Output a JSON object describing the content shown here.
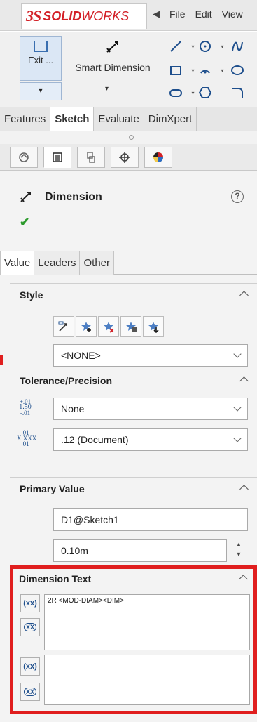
{
  "app": {
    "logo_mark": "3S",
    "logo_bold": "SOLID",
    "logo_rest": "WORKS",
    "menu_arrow": "◀",
    "menu": [
      "File",
      "Edit",
      "View"
    ]
  },
  "command_manager": {
    "exit_label": "Exit ...",
    "smart_dimension_label": "Smart Dimension",
    "dropdown_glyph": "▾"
  },
  "command_tabs": [
    "Features",
    "Sketch",
    "Evaluate",
    "DimXpert"
  ],
  "active_command_tab": "Sketch",
  "property_manager": {
    "title": "Dimension",
    "help_glyph": "?",
    "ok_glyph": "✔",
    "tabs": [
      "Value",
      "Leaders",
      "Other"
    ],
    "active_tab": "Value"
  },
  "style": {
    "heading": "Style",
    "selected": "<NONE>"
  },
  "tolerance": {
    "heading": "Tolerance/Precision",
    "tolerance_type": "None",
    "precision": ".12 (Document)",
    "tol_icon_lines": [
      "+.01",
      "1.50",
      "-.01"
    ],
    "prec_icon_lines": [
      ".01",
      "X.XXX",
      ".01"
    ]
  },
  "primary_value": {
    "heading": "Primary Value",
    "name": "D1@Sketch1",
    "value": "0.10m"
  },
  "dimension_text": {
    "heading": "Dimension Text",
    "upper_text": "2R <MOD-DIAM><DIM>",
    "lower_text": "",
    "btn_center": "(xx)",
    "btn_box": "XX"
  },
  "colors": {
    "highlight": "#e01e1e",
    "brand": "#d32027",
    "ok": "#2b9a2b"
  }
}
